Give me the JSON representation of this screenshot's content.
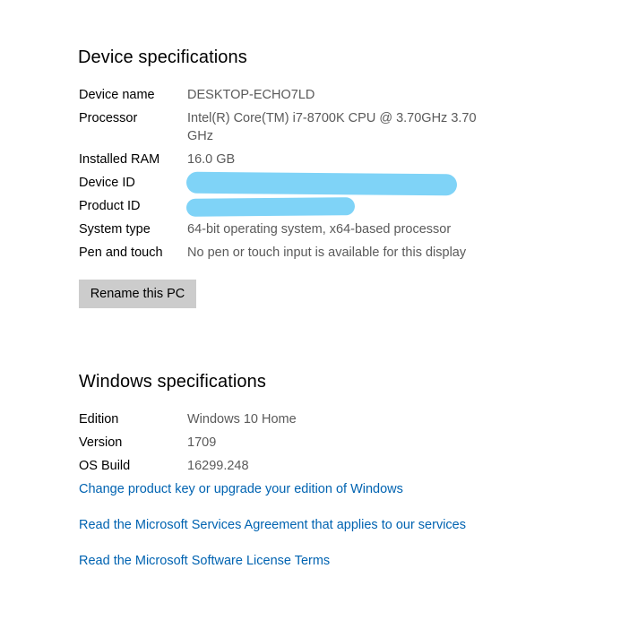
{
  "device_specs": {
    "title": "Device specifications",
    "rows": [
      {
        "label": "Device name",
        "value": "DESKTOP-ECHO7LD"
      },
      {
        "label": "Processor",
        "value": "Intel(R) Core(TM) i7-8700K CPU @ 3.70GHz   3.70 GHz"
      },
      {
        "label": "Installed RAM",
        "value": "16.0 GB"
      },
      {
        "label": "Device ID",
        "value": ""
      },
      {
        "label": "Product ID",
        "value": ""
      },
      {
        "label": "System type",
        "value": "64-bit operating system, x64-based processor"
      },
      {
        "label": "Pen and touch",
        "value": "No pen or touch input is available for this display"
      }
    ],
    "rename_button": "Rename this PC"
  },
  "windows_specs": {
    "title": "Windows specifications",
    "rows": [
      {
        "label": "Edition",
        "value": "Windows 10 Home"
      },
      {
        "label": "Version",
        "value": "1709"
      },
      {
        "label": "OS Build",
        "value": "16299.248"
      }
    ]
  },
  "links": [
    "Change product key or upgrade your edition of Windows",
    "Read the Microsoft Services Agreement that applies to our services",
    "Read the Microsoft Software License Terms"
  ],
  "colors": {
    "link": "#0063b1",
    "value_text": "#5a5a5a",
    "redaction": "#7fd3f7",
    "button_bg": "#cccccc"
  }
}
